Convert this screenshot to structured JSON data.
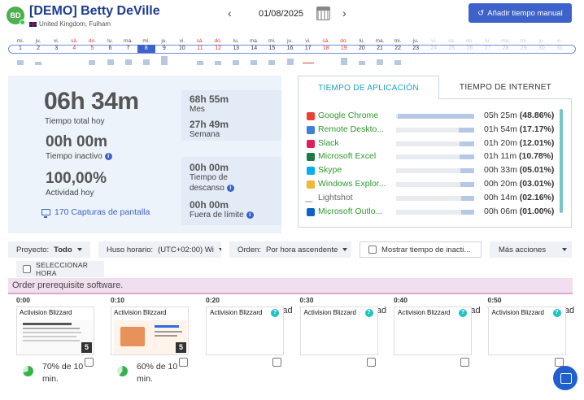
{
  "header": {
    "initials": "BD",
    "user_name": "[DEMO] Betty DeVille",
    "location": "United Kingdom, Fulham",
    "date": "01/08/2025",
    "prev_icon": "‹",
    "next_icon": "›",
    "add_time_label": "Añadir tiempo manual",
    "add_time_icon": "↺"
  },
  "timeline": [
    {
      "wd": "mi.",
      "d": "1",
      "weekend": false,
      "future": false,
      "bar": 0.5
    },
    {
      "wd": "ju.",
      "d": "2",
      "weekend": false,
      "future": false,
      "bar": 0.4
    },
    {
      "wd": "vi.",
      "d": "3",
      "weekend": false,
      "future": false,
      "bar": 0
    },
    {
      "wd": "sá.",
      "d": "4",
      "weekend": true,
      "future": false,
      "bar": 0
    },
    {
      "wd": "do.",
      "d": "5",
      "weekend": true,
      "future": false,
      "bar": 0.55
    },
    {
      "wd": "lu.",
      "d": "6",
      "weekend": false,
      "future": false,
      "bar": 0.6
    },
    {
      "wd": "ma.",
      "d": "7",
      "weekend": false,
      "future": false,
      "bar": 0.6
    },
    {
      "wd": "mi.",
      "d": "8",
      "weekend": false,
      "future": false,
      "bar": 0.6,
      "selected": true
    },
    {
      "wd": "ju.",
      "d": "9",
      "weekend": false,
      "future": false,
      "bar": 1.0
    },
    {
      "wd": "vi.",
      "d": "10",
      "weekend": false,
      "future": false,
      "bar": 0
    },
    {
      "wd": "sá.",
      "d": "11",
      "weekend": true,
      "future": false,
      "bar": 0.45
    },
    {
      "wd": "do.",
      "d": "12",
      "weekend": true,
      "future": false,
      "bar": 0.45
    },
    {
      "wd": "lu.",
      "d": "13",
      "weekend": false,
      "future": false,
      "bar": 0.5
    },
    {
      "wd": "ma.",
      "d": "14",
      "weekend": false,
      "future": false,
      "bar": 0.55
    },
    {
      "wd": "mi.",
      "d": "15",
      "weekend": false,
      "future": false,
      "bar": 0.5
    },
    {
      "wd": "ju.",
      "d": "16",
      "weekend": false,
      "future": false,
      "bar": 0.7
    },
    {
      "wd": "vi.",
      "d": "17",
      "weekend": false,
      "future": false,
      "bar": 0,
      "redline": true
    },
    {
      "wd": "sá.",
      "d": "18",
      "weekend": true,
      "future": false,
      "bar": 0
    },
    {
      "wd": "do.",
      "d": "19",
      "weekend": true,
      "future": false,
      "bar": 0.8
    },
    {
      "wd": "lu.",
      "d": "20",
      "weekend": false,
      "future": false,
      "bar": 0.45
    },
    {
      "wd": "ma.",
      "d": "21",
      "weekend": false,
      "future": false,
      "bar": 0.6
    },
    {
      "wd": "mi.",
      "d": "22",
      "weekend": false,
      "future": false,
      "bar": 0.5
    },
    {
      "wd": "ju.",
      "d": "23",
      "weekend": false,
      "future": false,
      "bar": 0
    },
    {
      "wd": "vi.",
      "d": "24",
      "weekend": false,
      "future": true,
      "bar": 0
    },
    {
      "wd": "sá.",
      "d": "25",
      "weekend": false,
      "future": true,
      "bar": 0
    },
    {
      "wd": "do.",
      "d": "26",
      "weekend": false,
      "future": true,
      "bar": 0
    },
    {
      "wd": "lu.",
      "d": "27",
      "weekend": false,
      "future": true,
      "bar": 0
    },
    {
      "wd": "ma.",
      "d": "28",
      "weekend": false,
      "future": true,
      "bar": 0
    },
    {
      "wd": "mi.",
      "d": "29",
      "weekend": false,
      "future": true,
      "bar": 0
    },
    {
      "wd": "ju.",
      "d": "30",
      "weekend": false,
      "future": true,
      "bar": 0
    },
    {
      "wd": "vi.",
      "d": "31",
      "weekend": false,
      "future": true,
      "bar": 0
    }
  ],
  "stats": {
    "total_today": "06h 34m",
    "total_today_label": "Tiempo total hoy",
    "month_value": "68h 55m",
    "month_label": "Mes",
    "week_value": "27h 49m",
    "week_label": "Semana",
    "idle_value": "00h 00m",
    "idle_label": "Tiempo inactivo",
    "activity_value": "100,00%",
    "activity_label": "Actividad hoy",
    "break_value": "00h 00m",
    "break_label_1": "Tiempo de",
    "break_label_2": "descanso",
    "offlimit_value": "00h 00m",
    "offlimit_label": "Fuera de límite",
    "screenshots_label": "170 Capturas de pantalla",
    "info_icon": "i"
  },
  "apps": {
    "tab_app": "TIEMPO DE APLICACIÓN",
    "tab_internet": "TIEMPO DE INTERNET",
    "rows": [
      {
        "name": "Google Chrome",
        "time": "05h 25m",
        "pct": "(48.86%)",
        "fill": 0.98,
        "icon": "chrome-icon",
        "color": "#e94235",
        "grey": false
      },
      {
        "name": "Remote Deskto...",
        "time": "01h 54m",
        "pct": "(17.17%)",
        "fill": 0.17,
        "icon": "remote-desktop-icon",
        "color": "#3d7fd9",
        "grey": false
      },
      {
        "name": "Slack",
        "time": "01h 20m",
        "pct": "(12.01%)",
        "fill": 0.12,
        "icon": "slack-icon",
        "color": "#e01e5a",
        "grey": false
      },
      {
        "name": "Microsoft Excel",
        "time": "01h 11m",
        "pct": "(10.78%)",
        "fill": 0.11,
        "icon": "excel-icon",
        "color": "#1d7a45",
        "grey": false
      },
      {
        "name": "Skype",
        "time": "00h 33m",
        "pct": "(05.01%)",
        "fill": 0.05,
        "icon": "skype-icon",
        "color": "#00aff0",
        "grey": false
      },
      {
        "name": "Windows Explor...",
        "time": "00h 20m",
        "pct": "(03.01%)",
        "fill": 0.03,
        "icon": "folder-icon",
        "color": "#f2b632",
        "grey": false
      },
      {
        "name": "Lightshot",
        "time": "00h 14m",
        "pct": "(02.16%)",
        "fill": 0.02,
        "icon": "feather-icon",
        "color": "#c8c8c8",
        "grey": true
      },
      {
        "name": "Microsoft Outlo...",
        "time": "00h 06m",
        "pct": "(01.00%)",
        "fill": 0.01,
        "icon": "outlook-icon",
        "color": "#0a64c8",
        "grey": false
      }
    ]
  },
  "filters": {
    "project_label": "Proyecto:",
    "project_value": "Todo",
    "timezone_label": "Huso horario:",
    "timezone_value": "(UTC+02:00) Wi",
    "order_label": "Orden:",
    "order_value": "Por hora ascendente",
    "show_idle_label": "Mostrar tiempo de inacti...",
    "more_actions": "Más acciones",
    "select_hour": "SELECCIONAR HORA"
  },
  "task": "Order prerequisite software.",
  "tiles": [
    {
      "time": "0:00",
      "app": "Activision Blizzard",
      "type": "shot",
      "count": "5",
      "activity_1": "70% de 10",
      "activity_2": "min.",
      "pct": 0.7
    },
    {
      "time": "0:10",
      "app": "Activision Blizzard",
      "type": "shot",
      "count": "5",
      "activity_1": "60% de 10",
      "activity_2": "min.",
      "pct": 0.6
    },
    {
      "time": "0:20",
      "app": "Activision Blizzard",
      "type": "idle",
      "msg": "Tiempo de inactividad del usuario"
    },
    {
      "time": "0:30",
      "app": "Activision Blizzard",
      "type": "idle",
      "msg": "Tiempo de inactividad del usuario"
    },
    {
      "time": "0:40",
      "app": "Activision Blizzard",
      "type": "idle",
      "msg": "Tiempo de inactividad del usuario"
    },
    {
      "time": "0:50",
      "app": "Activision Blizzard",
      "type": "idle",
      "msg": "Tiempo de inactividad del usuario"
    }
  ],
  "colors": {
    "brand": "#3d62c9",
    "accent": "#1ea1c9",
    "green": "#2e9a2e",
    "task_bg": "#f1dff0"
  }
}
